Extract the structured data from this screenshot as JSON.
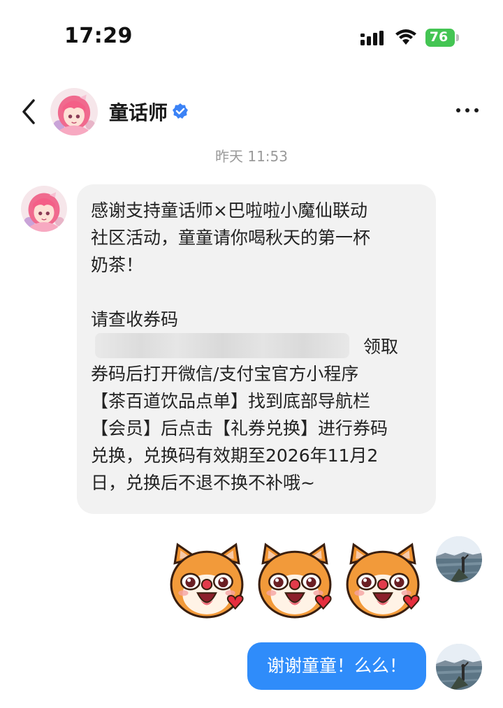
{
  "status_bar": {
    "time": "17:29",
    "battery": "76",
    "icons": [
      "signal-icon",
      "wifi-icon",
      "battery-icon"
    ]
  },
  "header": {
    "title": "童话师",
    "icons": [
      "back-arrow-icon",
      "verified-badge-icon",
      "more-options-icon"
    ]
  },
  "chat": {
    "timestamp": "昨天 11:53",
    "incoming_message": {
      "lines": [
        "感谢支持童话师×巴啦啦小魔仙联动",
        "社区活动，童童请你喝秋天的第一杯",
        "奶茶！",
        "",
        "请查收券码",
        "领取",
        "券码后打开微信/支付宝官方小程序",
        "【茶百道饮品点单】找到底部导航栏",
        "【会员】后点击【礼券兑换】进行券码",
        "兑换，兑换码有效期至2026年11月2",
        "日，兑换后不退不换不补哦~"
      ]
    },
    "sticker_count": 3,
    "outgoing_message": "谢谢童童！么么！"
  },
  "colors": {
    "outgoing_bubble": "#2f8cfa",
    "incoming_bubble": "#f2f2f2",
    "verified_badge": "#3b82f6",
    "battery": "#44c553"
  }
}
